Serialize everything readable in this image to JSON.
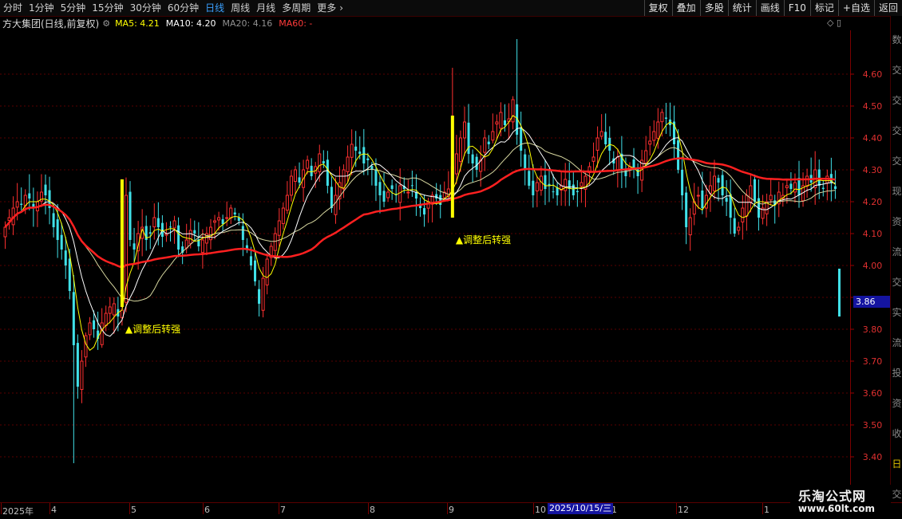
{
  "toolbar": {
    "periods": [
      {
        "label": "分时",
        "active": false
      },
      {
        "label": "1分钟",
        "active": false
      },
      {
        "label": "5分钟",
        "active": false
      },
      {
        "label": "15分钟",
        "active": false
      },
      {
        "label": "30分钟",
        "active": false
      },
      {
        "label": "60分钟",
        "active": false
      },
      {
        "label": "日线",
        "active": true
      },
      {
        "label": "周线",
        "active": false
      },
      {
        "label": "月线",
        "active": false
      },
      {
        "label": "多周期",
        "active": false
      },
      {
        "label": "更多",
        "active": false
      }
    ],
    "more_arrow": "›",
    "buttons": [
      "复权",
      "叠加",
      "多股",
      "统计",
      "画线",
      "F10",
      "标记",
      "+自选",
      "返回"
    ]
  },
  "legend": {
    "stock": "方大集团(日线,前复权)",
    "gear_icon": "gear-icon",
    "ma5": {
      "label": "MA5: 4.21",
      "color": "#ffff00"
    },
    "ma10": {
      "label": "MA10: 4.20",
      "color": "#ffffff"
    },
    "ma20": {
      "label": "MA20: 4.16",
      "color": "#909090"
    },
    "ma60": {
      "label": "MA60: -",
      "color": "#ff3a3a"
    }
  },
  "corner_icons": "◇ ▯",
  "right_strip": [
    "数",
    "交",
    "交",
    "交",
    "交",
    "现",
    "资",
    "流",
    "交",
    "实",
    "流",
    "投",
    "资",
    "收",
    "日",
    "交"
  ],
  "price_box": "3.86",
  "annotations": [
    "▲调整后转强",
    "▲调整后转强"
  ],
  "date_labels": [
    "2025年",
    "4",
    "5",
    "6",
    "7",
    "8",
    "9",
    "10",
    "11",
    "12",
    "1"
  ],
  "cursor_date": "2025/10/15/三",
  "watermark": {
    "line1": "乐淘公式网",
    "line2": "www.60lt.com"
  },
  "chart_data": {
    "type": "candlestick",
    "title": "方大集团(日线,前复权)",
    "ylim": [
      3.4,
      4.7
    ],
    "yticks": [
      3.4,
      3.5,
      3.6,
      3.7,
      3.8,
      3.9,
      4.0,
      4.1,
      4.2,
      4.3,
      4.4,
      4.5,
      4.6
    ],
    "ytick_labels": [
      "3.40",
      "3.50",
      "3.60",
      "3.70",
      "3.80",
      "",
      "4.00",
      "4.10",
      "4.20",
      "4.30",
      "4.40",
      "4.50",
      "4.60"
    ],
    "up_color": "#ff3030",
    "down_color": "#40e0e8",
    "closes": [
      4.12,
      4.15,
      4.18,
      4.2,
      4.19,
      4.22,
      4.21,
      4.18,
      4.2,
      4.23,
      4.22,
      4.18,
      4.12,
      4.08,
      4.05,
      4.0,
      3.92,
      3.75,
      3.62,
      3.7,
      3.78,
      3.82,
      3.8,
      3.77,
      3.82,
      3.85,
      3.87,
      3.88,
      3.84,
      3.86,
      4.22,
      4.08,
      4.05,
      4.1,
      4.12,
      4.08,
      4.1,
      4.15,
      4.12,
      4.09,
      4.1,
      4.12,
      4.14,
      4.05,
      4.04,
      4.08,
      4.11,
      4.1,
      4.06,
      4.08,
      4.1,
      4.12,
      4.14,
      4.15,
      4.13,
      4.15,
      4.18,
      4.16,
      4.14,
      4.08,
      4.05,
      4.0,
      3.95,
      3.88,
      3.96,
      4.02,
      4.06,
      4.1,
      4.14,
      4.18,
      4.22,
      4.28,
      4.3,
      4.26,
      4.3,
      4.33,
      4.28,
      4.31,
      4.35,
      4.32,
      4.25,
      4.18,
      4.22,
      4.26,
      4.3,
      4.34,
      4.38,
      4.36,
      4.35,
      4.32,
      4.33,
      4.3,
      4.25,
      4.22,
      4.2,
      4.23,
      4.24,
      4.22,
      4.25,
      4.24,
      4.23,
      4.25,
      4.21,
      4.18,
      4.16,
      4.2,
      4.22,
      4.21,
      4.19,
      4.23,
      4.24,
      4.31,
      4.35,
      4.4,
      4.45,
      4.35,
      4.32,
      4.3,
      4.33,
      4.4,
      4.38,
      4.42,
      4.45,
      4.48,
      4.44,
      4.46,
      4.52,
      4.41,
      4.36,
      4.3,
      4.25,
      4.22,
      4.26,
      4.28,
      4.24,
      4.25,
      4.23,
      4.22,
      4.25,
      4.27,
      4.24,
      4.22,
      4.23,
      4.26,
      4.28,
      4.31,
      4.34,
      4.4,
      4.42,
      4.38,
      4.36,
      4.32,
      4.34,
      4.3,
      4.28,
      4.31,
      4.3,
      4.28,
      4.33,
      4.36,
      4.39,
      4.42,
      4.45,
      4.48,
      4.46,
      4.44,
      4.38,
      4.3,
      4.22,
      4.12,
      4.15,
      4.2,
      4.22,
      4.18,
      4.22,
      4.25,
      4.28,
      4.26,
      4.22,
      4.2,
      4.15,
      4.1,
      4.12,
      4.18,
      4.22,
      4.25,
      4.2,
      4.15,
      4.18,
      4.2,
      4.22,
      4.19,
      4.23,
      4.22,
      4.25,
      4.24,
      4.26,
      4.22,
      4.25,
      4.28,
      4.26,
      4.3,
      4.25,
      4.24,
      4.28,
      4.26,
      4.24,
      3.86
    ],
    "series": [
      {
        "name": "MA5",
        "color": "#ffff00"
      },
      {
        "name": "MA10",
        "color": "#ffffff"
      },
      {
        "name": "MA20",
        "color": "#b0b0b0"
      },
      {
        "name": "MA60",
        "color": "#ff3a3a"
      }
    ],
    "signals": [
      {
        "index": 29,
        "low": 3.87,
        "high": 4.27,
        "label": "▲调整后转强",
        "label_price": 3.8
      },
      {
        "index": 111,
        "low": 4.15,
        "high": 4.47,
        "label": "▲调整后转强",
        "label_price": 4.08
      }
    ]
  }
}
